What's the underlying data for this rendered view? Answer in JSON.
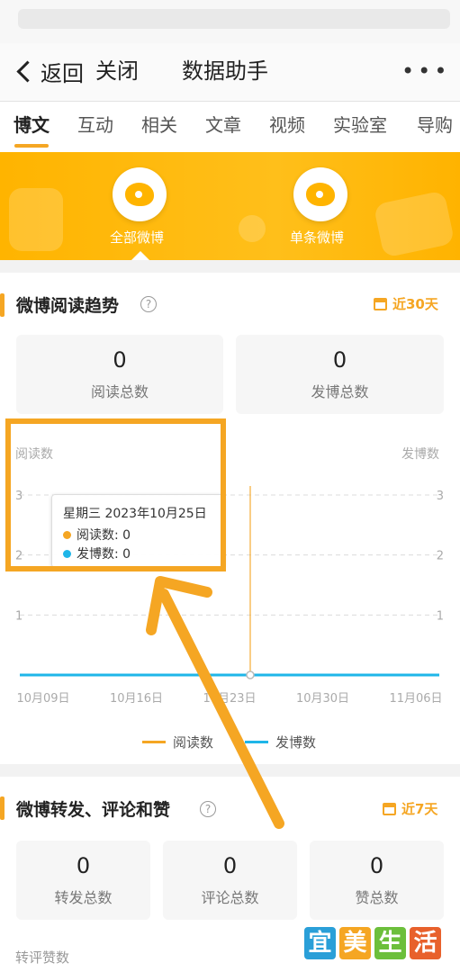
{
  "header": {
    "back_label": "返回",
    "close_label": "关闭",
    "title": "数据助手",
    "more_label": "•••"
  },
  "tabs": [
    {
      "label": "博文",
      "active": true
    },
    {
      "label": "互动"
    },
    {
      "label": "相关"
    },
    {
      "label": "文章"
    },
    {
      "label": "视频"
    },
    {
      "label": "实验室"
    },
    {
      "label": "导购"
    }
  ],
  "banner": {
    "all_label": "全部微博",
    "single_label": "单条微博",
    "color": "#ffb400"
  },
  "trend": {
    "title": "微博阅读趋势",
    "help_icon": "question-circle-icon",
    "period_label": "近30天",
    "stats": [
      {
        "value": "0",
        "label": "阅读总数"
      },
      {
        "value": "0",
        "label": "发博总数"
      }
    ]
  },
  "tooltip": {
    "title": "星期三 2023年10月25日",
    "rows": [
      "阅读数: 0",
      "发博数: 0"
    ]
  },
  "chart_data": {
    "type": "line",
    "x": [
      "10月09日",
      "10月16日",
      "10月23日",
      "10月30日",
      "11月06日"
    ],
    "y_left_label": "阅读数",
    "y_right_label": "发博数",
    "y_left_ticks": [
      "1",
      "2",
      "3"
    ],
    "y_right_ticks": [
      "1",
      "2",
      "3"
    ],
    "ylim": [
      0,
      3
    ],
    "grid": true,
    "legend_position": "bottom",
    "series": [
      {
        "name": "阅读数",
        "color": "#f5a623",
        "values": [
          0,
          0,
          0,
          0,
          0
        ]
      },
      {
        "name": "发博数",
        "color": "#1fb6e8",
        "values": [
          0,
          0,
          0,
          0,
          0
        ]
      }
    ]
  },
  "interact": {
    "title": "微博转发、评论和赞",
    "help_icon": "question-circle-icon",
    "period_label": "近7天",
    "stats": [
      {
        "value": "0",
        "label": "转发总数"
      },
      {
        "value": "0",
        "label": "评论总数"
      },
      {
        "value": "0",
        "label": "赞总数"
      }
    ],
    "footer_label": "转评赞数"
  },
  "watermark": {
    "chars": [
      "宜",
      "美",
      "生",
      "活"
    ],
    "colors": [
      "#2a9fd8",
      "#f5a623",
      "#6cbf3b",
      "#e8612c"
    ]
  },
  "colors": {
    "accent": "#f5a623",
    "blue": "#1fb6e8"
  }
}
